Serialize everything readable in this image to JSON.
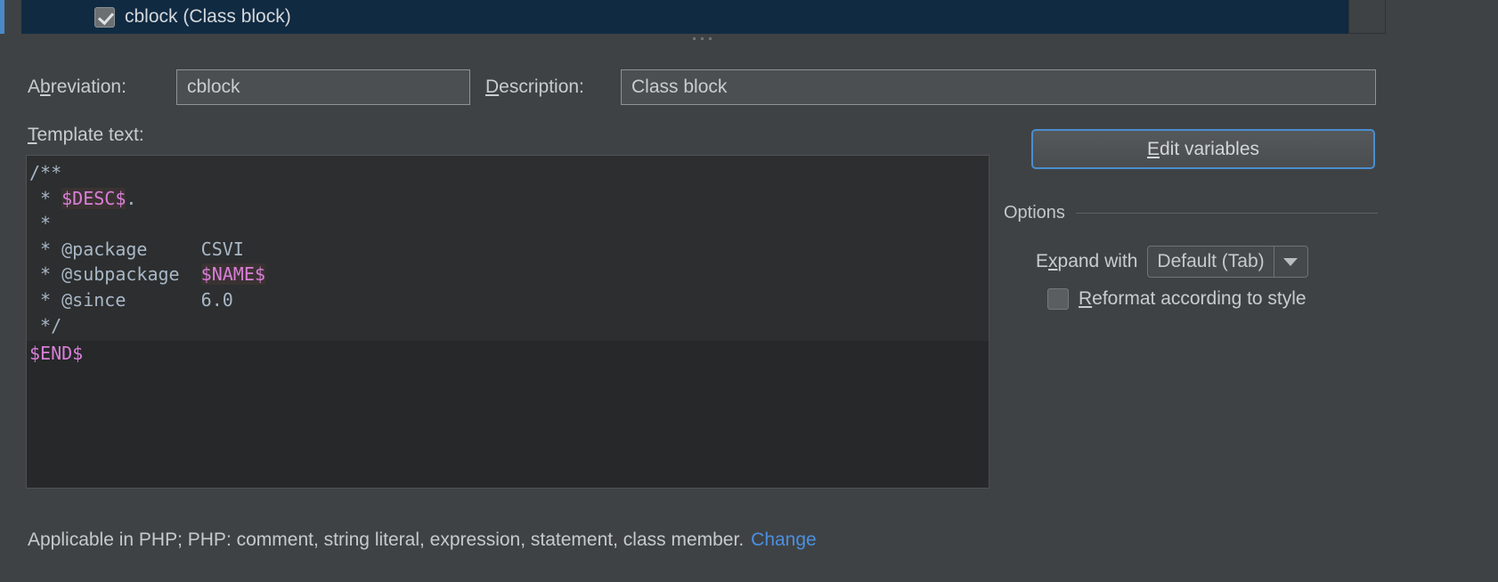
{
  "tree": {
    "selected_item": {
      "label": "cblock (Class block)",
      "checked": true,
      "checkbox_icon": "checkmark-icon"
    }
  },
  "splitter": {
    "icon": "drag-grip-icon",
    "dots": 6
  },
  "fields": {
    "abbreviation": {
      "label": "Abbreviation:",
      "mnemonic": "b",
      "label_pre": "A",
      "label_post": "reviation:",
      "value": "cblock",
      "placeholder": ""
    },
    "description": {
      "label": "Description:",
      "mnemonic": "D",
      "label_pre": "",
      "label_post": "escription:",
      "value": "Class block",
      "placeholder": ""
    }
  },
  "template_text": {
    "label": "Template text:",
    "mnemonic": "T",
    "label_post": "emplate text:",
    "lines_block": [
      "/**",
      " * $DESC$.",
      " *",
      " * @package     CSVI",
      " * @subpackage  $NAME$",
      " * @since       6.0",
      " */"
    ],
    "lines_rest": [
      "$END$"
    ],
    "variables": [
      "$DESC$",
      "$NAME$",
      "$END$"
    ],
    "static_values": {
      "package": "CSVI",
      "since": "6.0"
    }
  },
  "actions": {
    "edit_variables": {
      "label": "Edit variables",
      "mnemonic": "E",
      "label_pre": "E",
      "label_post": "dit variables",
      "focused": true
    }
  },
  "options": {
    "title": "Options",
    "expand_with": {
      "label": "Expand with",
      "mnemonic": "x",
      "label_pre": "E",
      "label_post": "pand with",
      "selected": "Default (Tab)",
      "arrow_icon": "chevron-down-icon"
    },
    "reformat": {
      "label": "Reformat according to style",
      "mnemonic": "R",
      "label_post": "eformat according to style",
      "checked": false
    }
  },
  "footer": {
    "text": "Applicable in PHP; PHP: comment, string literal, expression, statement, class member.",
    "link": "Change"
  },
  "colors": {
    "background": "#3f4244",
    "selection": "#102a42",
    "accent": "#4a88c7",
    "editor_bg": "#262829",
    "code_block_bg": "#2c2e2f",
    "variable": "#d97fd9",
    "link": "#4a90e2",
    "focus_outline": "#4a8ed0"
  }
}
